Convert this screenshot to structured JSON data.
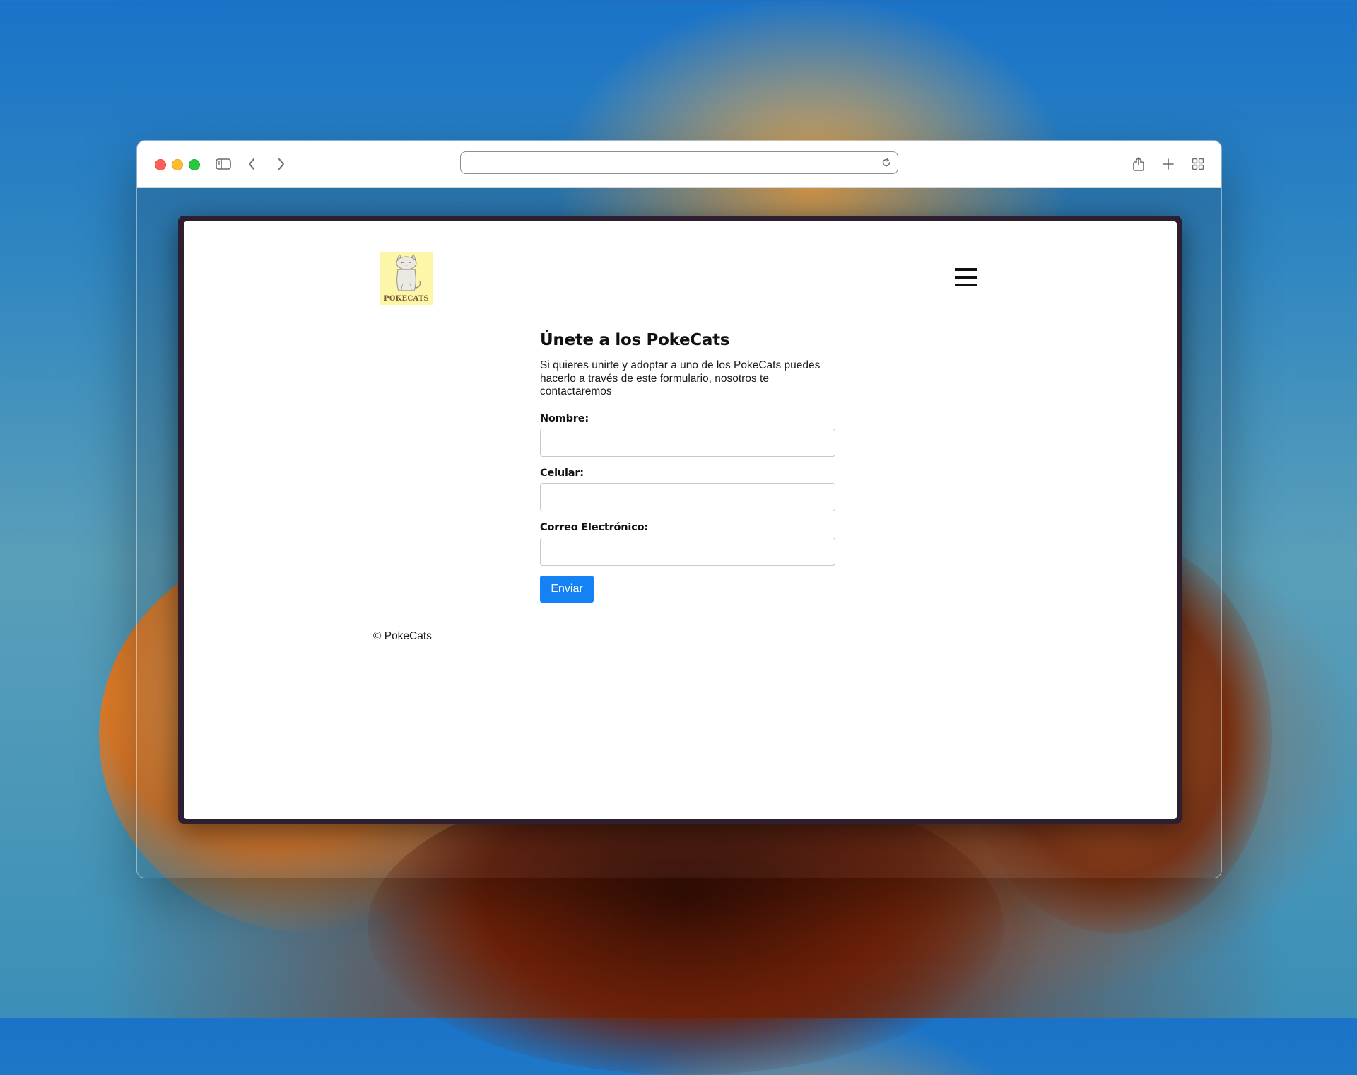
{
  "browser": {
    "address_value": "",
    "icons": {
      "sidebar": "sidebar-toggle-icon",
      "back": "chevron-left-icon",
      "forward": "chevron-right-icon",
      "reload": "reload-icon",
      "share": "share-icon",
      "new_tab": "plus-icon",
      "tab_overview": "tab-grid-icon"
    }
  },
  "header": {
    "logo_text": "POKECATS",
    "menu_icon": "hamburger-menu-icon"
  },
  "form": {
    "title": "Únete a los PokeCats",
    "description": "Si quieres unirte y adoptar a uno de los PokeCats puedes hacerlo a través de este formulario, nosotros te contactaremos",
    "fields": [
      {
        "label": "Nombre:",
        "value": ""
      },
      {
        "label": "Celular:",
        "value": ""
      },
      {
        "label": "Correo Electrónico:",
        "value": ""
      }
    ],
    "submit_label": "Enviar",
    "submit_color": "#1482f5"
  },
  "footer": {
    "text": "© PokeCats"
  }
}
